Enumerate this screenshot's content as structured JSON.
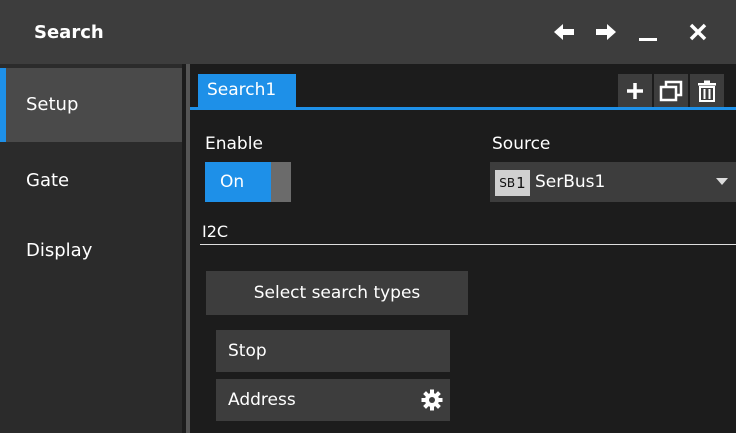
{
  "window": {
    "title": "Search",
    "icons": [
      "back-arrow-icon",
      "forward-arrow-icon",
      "minimize-icon",
      "close-icon"
    ]
  },
  "sidebar": {
    "items": [
      {
        "label": "Setup",
        "active": true
      },
      {
        "label": "Gate",
        "active": false
      },
      {
        "label": "Display",
        "active": false
      }
    ]
  },
  "tabs": {
    "active_label": "Search1",
    "actions": [
      "add-icon",
      "clone-window-icon",
      "delete-icon"
    ]
  },
  "setup": {
    "enable_label": "Enable",
    "enable_value": "On",
    "source_label": "Source",
    "source_badge_prefix": "SB",
    "source_badge_num": "1",
    "source_value": "SerBus1",
    "protocol_label": "I2C",
    "select_types_label": "Select search types",
    "search_types": [
      "Stop",
      "Address"
    ]
  },
  "colors": {
    "accent": "#1e90e8",
    "titlebar": "#3d3d3d",
    "sidebar": "#2b2b2b",
    "background": "#1c1c1c"
  }
}
